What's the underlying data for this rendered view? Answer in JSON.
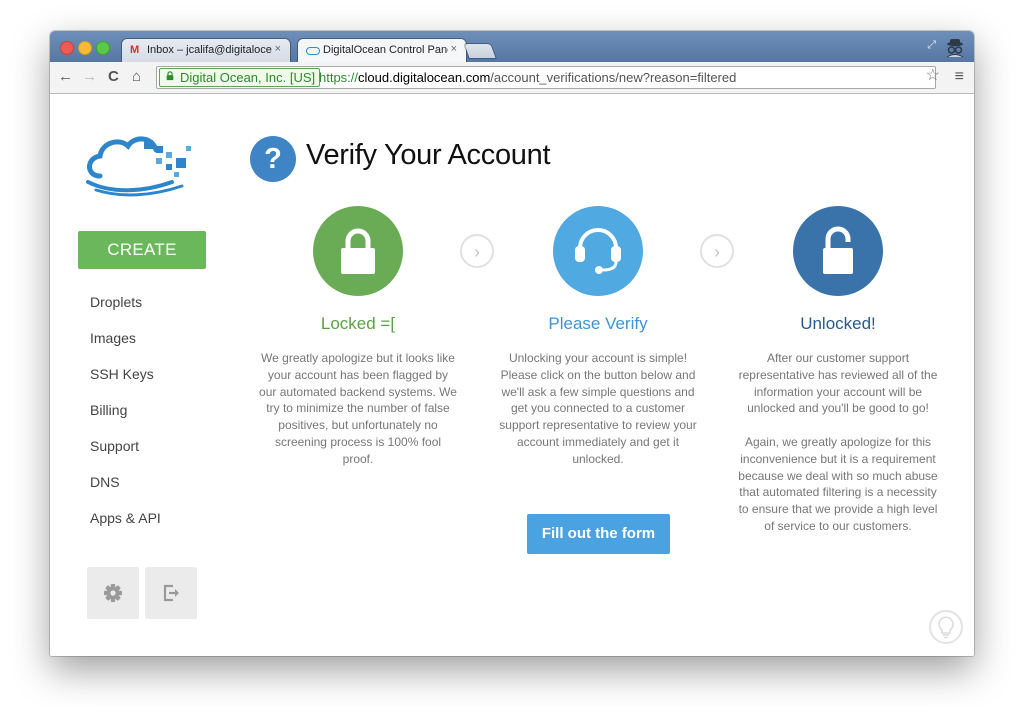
{
  "browser": {
    "tabs": [
      {
        "title": "Inbox – jcalifa@digitalocean",
        "favicon": "gmail-icon",
        "active": false
      },
      {
        "title": "DigitalOcean Control Panel",
        "favicon": "digitalocean-cloud-icon",
        "active": true
      }
    ],
    "close_glyph": "×",
    "ev_label": "Digital Ocean, Inc. [US]",
    "url": {
      "scheme": "https://",
      "host": "cloud.digitalocean.com",
      "path": "/account_verifications/new?reason=filtered"
    },
    "nav_glyphs": {
      "back": "←",
      "forward": "→",
      "reload": "C",
      "home": "⌂",
      "star": "☆",
      "menu": "≡"
    }
  },
  "sidebar": {
    "create_label": "CREATE",
    "items": [
      {
        "label": "Droplets"
      },
      {
        "label": "Images"
      },
      {
        "label": "SSH Keys"
      },
      {
        "label": "Billing"
      },
      {
        "label": "Support"
      },
      {
        "label": "DNS"
      },
      {
        "label": "Apps & API"
      }
    ]
  },
  "main": {
    "question_glyph": "?",
    "title": "Verify Your Account",
    "arrow_glyph": "›",
    "steps": [
      {
        "icon": "padlock-locked-icon",
        "title": "Locked =[",
        "paragraphs": [
          "We greatly apologize but it looks like your account has been flagged by our automated backend systems. We try to minimize the number of false positives, but unfortunately no screening process is 100% fool proof."
        ]
      },
      {
        "icon": "headset-icon",
        "title": "Please Verify",
        "paragraphs": [
          "Unlocking your account is simple! Please click on the button below and we'll ask a few simple questions and get you connected to a customer support representative to review your account immediately and get it unlocked."
        ]
      },
      {
        "icon": "padlock-unlocked-icon",
        "title": "Unlocked!",
        "paragraphs": [
          "After our customer support representative has reviewed all of the information your account will be unlocked and you'll be good to go!",
          "Again, we greatly apologize for this inconvenience but it is a requirement because we deal with so much abuse that automated filtering is a necessity to ensure that we provide a high level of service to our customers."
        ]
      }
    ],
    "fill_form_label": "Fill out the form"
  },
  "colors": {
    "create_green": "#6bb75c",
    "locked_green": "#6aac55",
    "verify_blue": "#50a9e1",
    "unlocked_dark_blue": "#3a73aa",
    "button_blue": "#4aa3e0",
    "question_blue": "#3f84c5"
  }
}
